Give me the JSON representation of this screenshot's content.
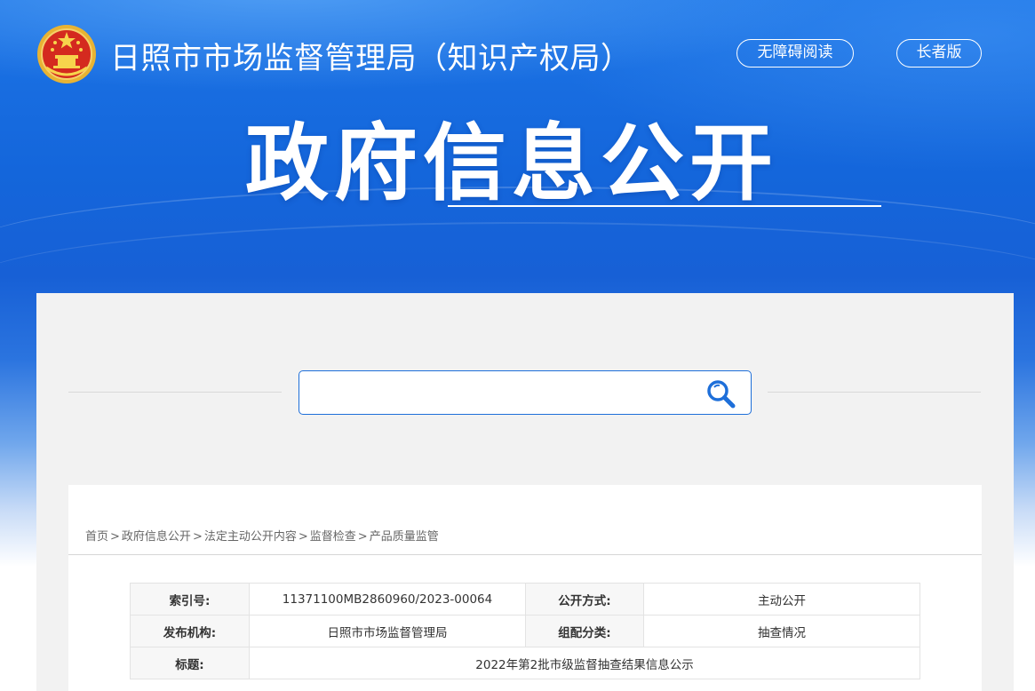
{
  "header": {
    "site_title": "日照市市场监督管理局（知识产权局）",
    "accessibility_label": "无障碍阅读",
    "elder_label": "长者版",
    "hero_title": "政府信息公开"
  },
  "search": {
    "placeholder": "",
    "value": ""
  },
  "breadcrumb": {
    "items": [
      "首页",
      "政府信息公开",
      "法定主动公开内容",
      "监督检查",
      "产品质量监管"
    ],
    "separator": ">"
  },
  "info": {
    "index_label": "索引号:",
    "index_value": "11371100MB2860960/2023-00064",
    "method_label": "公开方式:",
    "method_value": "主动公开",
    "publisher_label": "发布机构:",
    "publisher_value": "日照市市场监督管理局",
    "category_label": "组配分类:",
    "category_value": "抽查情况",
    "title_label": "标题:",
    "title_value": "2022年第2批市级监督抽查结果信息公示"
  },
  "colors": {
    "banner_blue": "#1466db",
    "accent": "#1e6fd9",
    "panel_bg": "#f2f2f2"
  },
  "icons": {
    "emblem": "national-emblem-icon",
    "search": "search-icon"
  }
}
